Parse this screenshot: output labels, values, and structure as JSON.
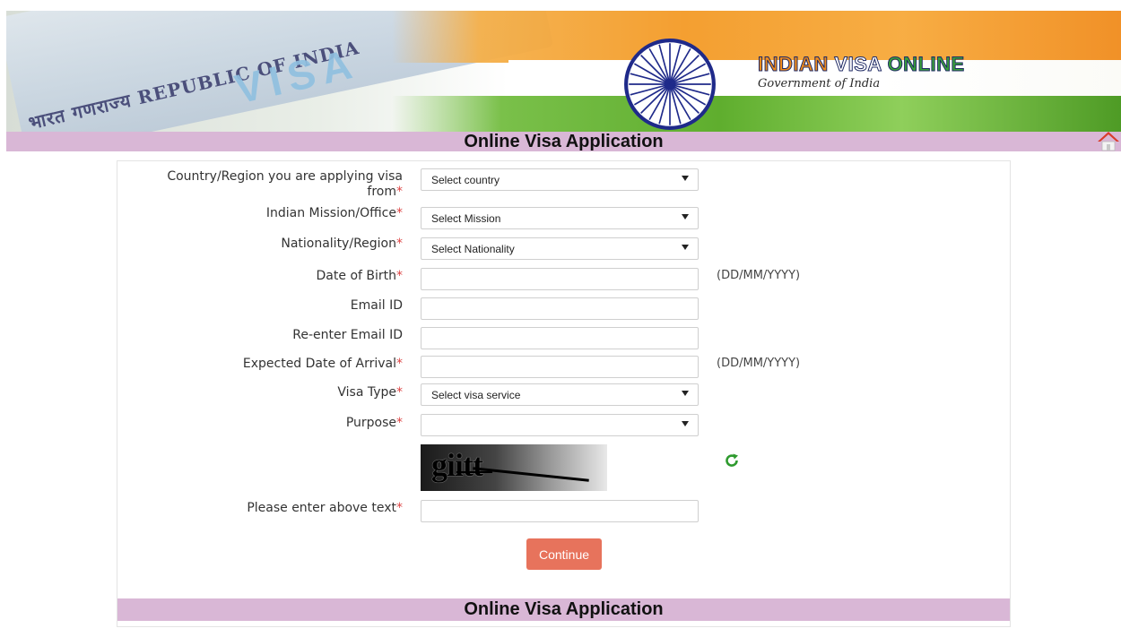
{
  "banner": {
    "passport_text": "भारत गणराज्य REPUBLIC OF INDIA",
    "passport_visa": "VISA",
    "brand_part1": "INDIAN",
    "brand_part2": "VISA",
    "brand_part3": "ONLINE",
    "brand_sub": "Government of India"
  },
  "header": {
    "title": "Online Visa Application",
    "home_icon": "home-icon"
  },
  "form": {
    "fields": [
      {
        "label": "Country/Region you are applying visa from",
        "required": true,
        "type": "select",
        "value": "Select country"
      },
      {
        "label": "Indian Mission/Office",
        "required": true,
        "type": "select",
        "value": "Select Mission"
      },
      {
        "label": "Nationality/Region",
        "required": true,
        "type": "select",
        "value": "Select Nationality"
      },
      {
        "label": "Date of Birth",
        "required": true,
        "type": "text",
        "value": "",
        "hint": "(DD/MM/YYYY)"
      },
      {
        "label": "Email ID",
        "required": false,
        "type": "text",
        "value": ""
      },
      {
        "label": "Re-enter Email ID",
        "required": false,
        "type": "text",
        "value": ""
      },
      {
        "label": "Expected Date of Arrival",
        "required": true,
        "type": "text",
        "value": "",
        "hint": "(DD/MM/YYYY)"
      },
      {
        "label": "Visa Type",
        "required": true,
        "type": "select",
        "value": "Select visa service"
      },
      {
        "label": "Purpose",
        "required": true,
        "type": "select",
        "value": ""
      }
    ],
    "captcha_text": "giitt",
    "captcha_label": "Please enter above text",
    "captcha_value": "",
    "refresh_icon": "refresh-icon",
    "continue_label": "Continue",
    "required_marker": "*"
  },
  "footer": {
    "title": "Online Visa Application"
  },
  "colors": {
    "bar": "#d9b7d6",
    "button": "#e7735c",
    "required": "#dd4444",
    "refresh": "#2e9a2e"
  }
}
